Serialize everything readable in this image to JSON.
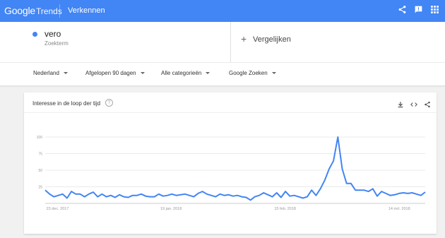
{
  "header": {
    "logo_google": "Google",
    "logo_trends": "Trends",
    "nav_title": "Verkennen"
  },
  "term": {
    "name": "vero",
    "type": "Zoekterm",
    "color": "#4285f4"
  },
  "compare": {
    "label": "Vergelijken"
  },
  "filters": [
    {
      "label": "Nederland"
    },
    {
      "label": "Afgelopen 90 dagen"
    },
    {
      "label": "Alle categorieën"
    },
    {
      "label": "Google Zoeken"
    }
  ],
  "card": {
    "title": "Interesse in de loop der tijd"
  },
  "chart_data": {
    "type": "line",
    "title": "Interesse in de loop der tijd",
    "ylim": [
      0,
      100
    ],
    "y_ticks": [
      "100",
      "75",
      "50",
      "25"
    ],
    "x_tick_labels": [
      "23 dec. 2017",
      "19 jan. 2018",
      "15 feb. 2018",
      "14 mrt. 2018"
    ],
    "grid": true,
    "line_color": "#4285f4",
    "series": [
      {
        "values": [
          20,
          14,
          10,
          12,
          14,
          8,
          18,
          14,
          14,
          10,
          14,
          17,
          10,
          14,
          10,
          12,
          9,
          13,
          10,
          9,
          12,
          12,
          14,
          11,
          10,
          10,
          14,
          11,
          12,
          14,
          12,
          13,
          14,
          12,
          10,
          15,
          18,
          14,
          12,
          10,
          14,
          12,
          13,
          11,
          12,
          10,
          9,
          5,
          10,
          12,
          16,
          13,
          10,
          16,
          9,
          18,
          11,
          12,
          10,
          8,
          10,
          20,
          12,
          22,
          35,
          52,
          64,
          100,
          52,
          30,
          30,
          20,
          20,
          20,
          18,
          22,
          11,
          18,
          15,
          12,
          13,
          15,
          16,
          15,
          16,
          14,
          12,
          17
        ]
      }
    ]
  }
}
